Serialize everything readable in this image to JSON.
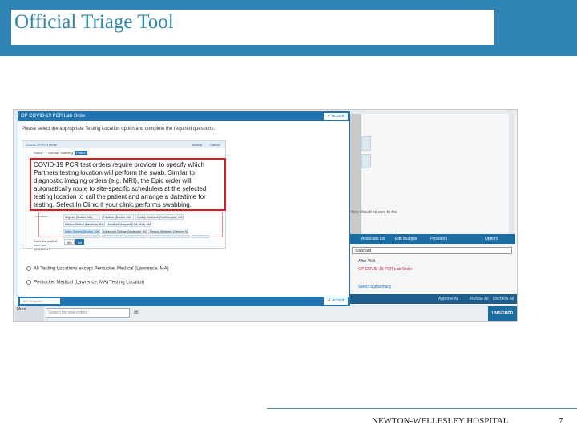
{
  "slide": {
    "title": "Official Triage Tool",
    "footer": "NEWTON-WELLESLEY HOSPITAL",
    "page_number": "7"
  },
  "dialog": {
    "title": "OP COVID-19 PCR Lab Order",
    "accept_label": "Accept",
    "instruction": "Please select the appropriate Testing Location option and complete the required questions.",
    "inner_header": "COVID-19 PCR Order",
    "inner_accept": "Accept",
    "inner_cancel": "Cancel",
    "status_label": "Status:",
    "tab_normal": "Normal",
    "tab_standing": "Standing",
    "tab_future": "Future",
    "notice_lines": [
      "COVID-19 PCR test orders require provider to specify which",
      "Partners testing location will perform the swab. Similar to",
      "diagnostic imaging orders (e.g. MRI), the Epic order will",
      "automatically route to site-specific schedulers at the selected",
      "testing location to call the patient and arrange a date/time for",
      "testing. Select In Clinic if your clinic performs swabbing."
    ],
    "location_label": "Location:",
    "locations": [
      "Brigham (Boston, MA)",
      "Faulkner (Boston, MA)",
      "Cooley Dickinson (Northampton, MA)",
      "Harbor Medical (Needham, MA)",
      "Martha's Vineyard (Oak Bluffs, MA)",
      "Mass General (Boston, MA)",
      "Nantucket Cottage (Nantucket, MA)",
      "Newton-Wellesley (Newton, MA)",
      "North Shore (Salem, MA)",
      "Partners Urgent Care (Danvers, MA)",
      "Pentucket Medical (Lawrence, MA)",
      "In Clinic"
    ],
    "question_label": "Does the patient have any symptoms?",
    "answer_yes": "Yes",
    "answer_no": "No",
    "radio_options": [
      "All Testing Locations except Pentucket Medical (Lawrence, MA)",
      "Pentucket Medical (Lawrence, MA) Testing Location"
    ],
    "next_required": "Next Required"
  },
  "background": {
    "toolbar": [
      "Associate Dx",
      "Edit Multiple",
      "Providers",
      "Options"
    ],
    "select_value": "Standard",
    "order_items": [
      "After Visit",
      "OP COVID-19 PCR Lab Order",
      "Select a pharmacy"
    ],
    "bottom_actions": [
      "Approve All",
      "Refuse All",
      "Uncheck All"
    ],
    "side_text": "they should be sent to the",
    "search_placeholder": "Search for new orders",
    "more_label": "More",
    "unsigned_orders": "UNSIGNED ORDERS"
  },
  "colors": {
    "header_blue": "#2f86b4",
    "dialog_blue": "#1e73b0",
    "highlight_red": "#e01a1a"
  }
}
